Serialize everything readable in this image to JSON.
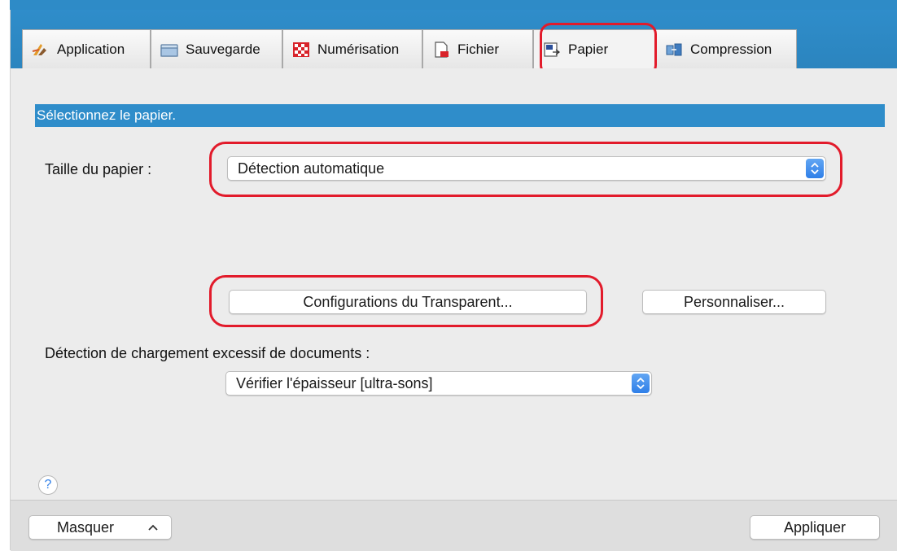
{
  "tabs": [
    {
      "label": "Application",
      "icon": "application-icon"
    },
    {
      "label": "Sauvegarde",
      "icon": "folder-icon"
    },
    {
      "label": "Numérisation",
      "icon": "scan-icon"
    },
    {
      "label": "Fichier",
      "icon": "file-icon"
    },
    {
      "label": "Papier",
      "icon": "paper-icon"
    },
    {
      "label": "Compression",
      "icon": "compression-icon"
    }
  ],
  "active_tab": "Papier",
  "section": {
    "title": "Sélectionnez le papier."
  },
  "paper_size": {
    "label": "Taille du papier :",
    "value": "Détection automatique"
  },
  "buttons": {
    "transparent": "Configurations du Transparent...",
    "customize": "Personnaliser..."
  },
  "overload": {
    "label": "Détection de chargement excessif de documents :",
    "value": "Vérifier l'épaisseur [ultra-sons]"
  },
  "help": {
    "symbol": "?"
  },
  "footer": {
    "hide_label": "Masquer",
    "apply_label": "Appliquer"
  },
  "colors": {
    "accent": "#2f8dca",
    "highlight": "#e21b2b"
  }
}
